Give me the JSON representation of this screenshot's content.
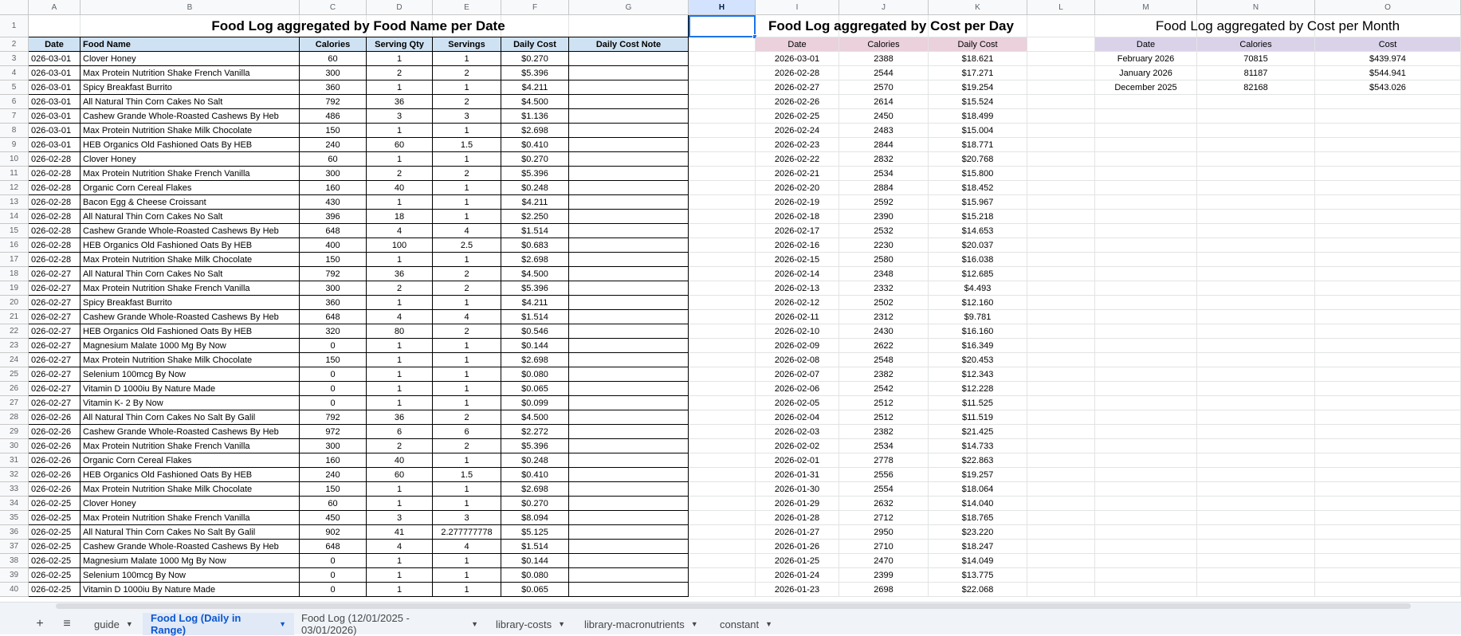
{
  "columns": [
    "A",
    "B",
    "C",
    "D",
    "E",
    "F",
    "G",
    "H",
    "I",
    "J",
    "K",
    "L",
    "M",
    "N",
    "O"
  ],
  "selected_column": "H",
  "rows_visible": [
    1,
    2,
    3,
    4,
    5,
    6,
    7,
    8,
    9,
    10,
    11,
    12,
    13,
    14,
    15,
    16,
    17,
    18,
    19,
    20,
    21,
    22,
    23,
    24,
    25,
    26,
    27,
    28,
    29,
    30,
    31,
    32,
    33,
    34,
    35,
    36,
    37,
    38,
    39,
    40
  ],
  "food_log": {
    "title": "Food Log aggregated by Food Name per Date",
    "headers": [
      "Date",
      "Food Name",
      "Calories",
      "Serving Qty",
      "Servings",
      "Daily Cost",
      "Daily Cost Note"
    ],
    "rows": [
      [
        "026-03-01",
        "Clover Honey",
        "60",
        "1",
        "1",
        "$0.270",
        ""
      ],
      [
        "026-03-01",
        "Max Protein Nutrition Shake French Vanilla",
        "300",
        "2",
        "2",
        "$5.396",
        ""
      ],
      [
        "026-03-01",
        "Spicy Breakfast Burrito",
        "360",
        "1",
        "1",
        "$4.211",
        ""
      ],
      [
        "026-03-01",
        "All Natural Thin Corn Cakes No Salt",
        "792",
        "36",
        "2",
        "$4.500",
        ""
      ],
      [
        "026-03-01",
        "Cashew Grande Whole-Roasted Cashews By Heb",
        "486",
        "3",
        "3",
        "$1.136",
        ""
      ],
      [
        "026-03-01",
        "Max Protein Nutrition Shake Milk Chocolate",
        "150",
        "1",
        "1",
        "$2.698",
        ""
      ],
      [
        "026-03-01",
        "HEB Organics Old Fashioned Oats By HEB",
        "240",
        "60",
        "1.5",
        "$0.410",
        ""
      ],
      [
        "026-02-28",
        "Clover Honey",
        "60",
        "1",
        "1",
        "$0.270",
        ""
      ],
      [
        "026-02-28",
        "Max Protein Nutrition Shake French Vanilla",
        "300",
        "2",
        "2",
        "$5.396",
        ""
      ],
      [
        "026-02-28",
        "Organic Corn Cereal Flakes",
        "160",
        "40",
        "1",
        "$0.248",
        ""
      ],
      [
        "026-02-28",
        "Bacon Egg & Cheese Croissant",
        "430",
        "1",
        "1",
        "$4.211",
        ""
      ],
      [
        "026-02-28",
        "All Natural Thin Corn Cakes No Salt",
        "396",
        "18",
        "1",
        "$2.250",
        ""
      ],
      [
        "026-02-28",
        "Cashew Grande Whole-Roasted Cashews By Heb",
        "648",
        "4",
        "4",
        "$1.514",
        ""
      ],
      [
        "026-02-28",
        "HEB Organics Old Fashioned Oats By HEB",
        "400",
        "100",
        "2.5",
        "$0.683",
        ""
      ],
      [
        "026-02-28",
        "Max Protein Nutrition Shake Milk Chocolate",
        "150",
        "1",
        "1",
        "$2.698",
        ""
      ],
      [
        "026-02-27",
        "All Natural Thin Corn Cakes No Salt",
        "792",
        "36",
        "2",
        "$4.500",
        ""
      ],
      [
        "026-02-27",
        "Max Protein Nutrition Shake French Vanilla",
        "300",
        "2",
        "2",
        "$5.396",
        ""
      ],
      [
        "026-02-27",
        "Spicy Breakfast Burrito",
        "360",
        "1",
        "1",
        "$4.211",
        ""
      ],
      [
        "026-02-27",
        "Cashew Grande Whole-Roasted Cashews By Heb",
        "648",
        "4",
        "4",
        "$1.514",
        ""
      ],
      [
        "026-02-27",
        "HEB Organics Old Fashioned Oats By HEB",
        "320",
        "80",
        "2",
        "$0.546",
        ""
      ],
      [
        "026-02-27",
        "Magnesium Malate 1000 Mg By Now",
        "0",
        "1",
        "1",
        "$0.144",
        ""
      ],
      [
        "026-02-27",
        "Max Protein Nutrition Shake Milk Chocolate",
        "150",
        "1",
        "1",
        "$2.698",
        ""
      ],
      [
        "026-02-27",
        "Selenium 100mcg By Now",
        "0",
        "1",
        "1",
        "$0.080",
        ""
      ],
      [
        "026-02-27",
        "Vitamin D 1000iu By Nature Made",
        "0",
        "1",
        "1",
        "$0.065",
        ""
      ],
      [
        "026-02-27",
        "Vitamin K- 2 By Now",
        "0",
        "1",
        "1",
        "$0.099",
        ""
      ],
      [
        "026-02-26",
        "All Natural Thin Corn Cakes No Salt By Galil",
        "792",
        "36",
        "2",
        "$4.500",
        ""
      ],
      [
        "026-02-26",
        "Cashew Grande Whole-Roasted Cashews By Heb",
        "972",
        "6",
        "6",
        "$2.272",
        ""
      ],
      [
        "026-02-26",
        "Max Protein Nutrition Shake French Vanilla",
        "300",
        "2",
        "2",
        "$5.396",
        ""
      ],
      [
        "026-02-26",
        "Organic Corn Cereal Flakes",
        "160",
        "40",
        "1",
        "$0.248",
        ""
      ],
      [
        "026-02-26",
        "HEB Organics Old Fashioned Oats By HEB",
        "240",
        "60",
        "1.5",
        "$0.410",
        ""
      ],
      [
        "026-02-26",
        "Max Protein Nutrition Shake Milk Chocolate",
        "150",
        "1",
        "1",
        "$2.698",
        ""
      ],
      [
        "026-02-25",
        "Clover Honey",
        "60",
        "1",
        "1",
        "$0.270",
        ""
      ],
      [
        "026-02-25",
        "Max Protein Nutrition Shake French Vanilla",
        "450",
        "3",
        "3",
        "$8.094",
        ""
      ],
      [
        "026-02-25",
        "All Natural Thin Corn Cakes No Salt By Galil",
        "902",
        "41",
        "2.277777778",
        "$5.125",
        ""
      ],
      [
        "026-02-25",
        "Cashew Grande Whole-Roasted Cashews By Heb",
        "648",
        "4",
        "4",
        "$1.514",
        ""
      ],
      [
        "026-02-25",
        "Magnesium Malate 1000 Mg By Now",
        "0",
        "1",
        "1",
        "$0.144",
        ""
      ],
      [
        "026-02-25",
        "Selenium 100mcg By Now",
        "0",
        "1",
        "1",
        "$0.080",
        ""
      ],
      [
        "026-02-25",
        "Vitamin D 1000iu By Nature Made",
        "0",
        "1",
        "1",
        "$0.065",
        ""
      ]
    ]
  },
  "daily": {
    "title": "Food Log aggregated by Cost per Day",
    "headers": [
      "Date",
      "Calories",
      "Daily Cost"
    ],
    "rows": [
      [
        "2026-03-01",
        "2388",
        "$18.621"
      ],
      [
        "2026-02-28",
        "2544",
        "$17.271"
      ],
      [
        "2026-02-27",
        "2570",
        "$19.254"
      ],
      [
        "2026-02-26",
        "2614",
        "$15.524"
      ],
      [
        "2026-02-25",
        "2450",
        "$18.499"
      ],
      [
        "2026-02-24",
        "2483",
        "$15.004"
      ],
      [
        "2026-02-23",
        "2844",
        "$18.771"
      ],
      [
        "2026-02-22",
        "2832",
        "$20.768"
      ],
      [
        "2026-02-21",
        "2534",
        "$15.800"
      ],
      [
        "2026-02-20",
        "2884",
        "$18.452"
      ],
      [
        "2026-02-19",
        "2592",
        "$15.967"
      ],
      [
        "2026-02-18",
        "2390",
        "$15.218"
      ],
      [
        "2026-02-17",
        "2532",
        "$14.653"
      ],
      [
        "2026-02-16",
        "2230",
        "$20.037"
      ],
      [
        "2026-02-15",
        "2580",
        "$16.038"
      ],
      [
        "2026-02-14",
        "2348",
        "$12.685"
      ],
      [
        "2026-02-13",
        "2332",
        "$4.493"
      ],
      [
        "2026-02-12",
        "2502",
        "$12.160"
      ],
      [
        "2026-02-11",
        "2312",
        "$9.781"
      ],
      [
        "2026-02-10",
        "2430",
        "$16.160"
      ],
      [
        "2026-02-09",
        "2622",
        "$16.349"
      ],
      [
        "2026-02-08",
        "2548",
        "$20.453"
      ],
      [
        "2026-02-07",
        "2382",
        "$12.343"
      ],
      [
        "2026-02-06",
        "2542",
        "$12.228"
      ],
      [
        "2026-02-05",
        "2512",
        "$11.525"
      ],
      [
        "2026-02-04",
        "2512",
        "$11.519"
      ],
      [
        "2026-02-03",
        "2382",
        "$21.425"
      ],
      [
        "2026-02-02",
        "2534",
        "$14.733"
      ],
      [
        "2026-02-01",
        "2778",
        "$22.863"
      ],
      [
        "2026-01-31",
        "2556",
        "$19.257"
      ],
      [
        "2026-01-30",
        "2554",
        "$18.064"
      ],
      [
        "2026-01-29",
        "2632",
        "$14.040"
      ],
      [
        "2026-01-28",
        "2712",
        "$18.765"
      ],
      [
        "2026-01-27",
        "2950",
        "$23.220"
      ],
      [
        "2026-01-26",
        "2710",
        "$18.247"
      ],
      [
        "2026-01-25",
        "2470",
        "$14.049"
      ],
      [
        "2026-01-24",
        "2399",
        "$13.775"
      ],
      [
        "2026-01-23",
        "2698",
        "$22.068"
      ]
    ]
  },
  "monthly": {
    "title": "Food Log aggregated by Cost per Month",
    "headers": [
      "Date",
      "Calories",
      "Cost"
    ],
    "rows": [
      [
        "February 2026",
        "70815",
        "$439.974"
      ],
      [
        "January 2026",
        "81187",
        "$544.941"
      ],
      [
        "December 2025",
        "82168",
        "$543.026"
      ]
    ]
  },
  "tabs": [
    {
      "label": "guide",
      "active": false
    },
    {
      "label": "Food Log (Daily in Range)",
      "active": true
    },
    {
      "label": "Food Log (12/01/2025 - 03/01/2026)",
      "active": false
    },
    {
      "label": "library-costs",
      "active": false
    },
    {
      "label": "library-macronutrients",
      "active": false
    },
    {
      "label": "constant",
      "active": false
    }
  ],
  "icons": {
    "add": "plus-icon",
    "all_sheets": "menu-icon",
    "tab_menu": "caret-down-icon"
  },
  "colors": {
    "blue_header": "#cfe2f3",
    "pink_header": "#ead1dc",
    "lavender_header": "#d9d2e9",
    "selection": "#1a73e8",
    "active_tab": "#0b57d0"
  }
}
